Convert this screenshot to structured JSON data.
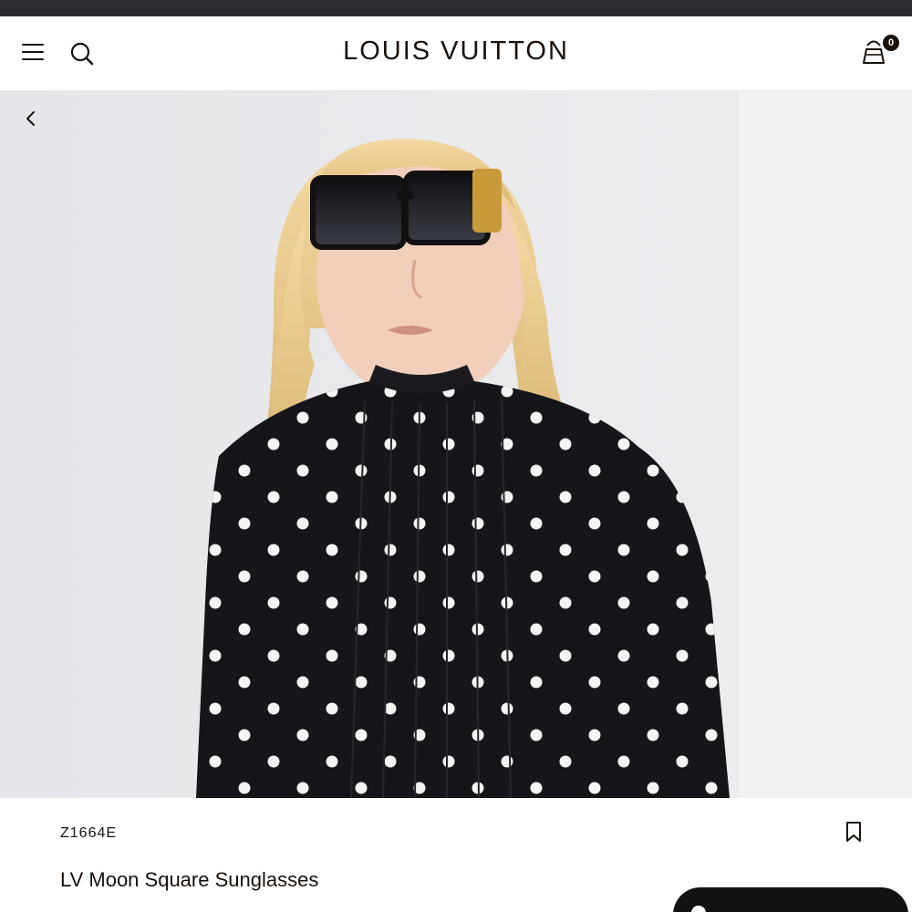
{
  "header": {
    "logo": "LOUIS VUITTON",
    "cart_count": "0"
  },
  "icons": {
    "menu": "menu-icon",
    "search": "search-icon",
    "cart": "shopping-bag-icon",
    "back": "chevron-left-icon",
    "bookmark": "bookmark-icon"
  },
  "product": {
    "sku": "Z1664E",
    "name": "LV Moon Square Sunglasses"
  },
  "colors": {
    "brand_text": "#19110b",
    "status_strip": "#2a2c31",
    "background": "#ffffff"
  }
}
